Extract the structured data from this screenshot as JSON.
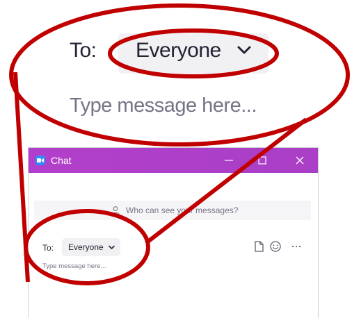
{
  "zoom": {
    "to_label": "To:",
    "recipient": "Everyone",
    "placeholder": "Type message here..."
  },
  "window": {
    "title": "Chat",
    "icon": "zoom-camera-icon",
    "titlebar_color": "#b23fcb",
    "controls": [
      "minimize-icon",
      "maximize-icon",
      "close-icon"
    ]
  },
  "chat": {
    "privacy_text": "Who can see your messages?",
    "to_label": "To:",
    "recipient": "Everyone",
    "placeholder": "Type message here...",
    "tools": [
      "file-icon",
      "emoji-icon",
      "more-icon"
    ]
  },
  "annotation": {
    "color": "#c00000"
  }
}
